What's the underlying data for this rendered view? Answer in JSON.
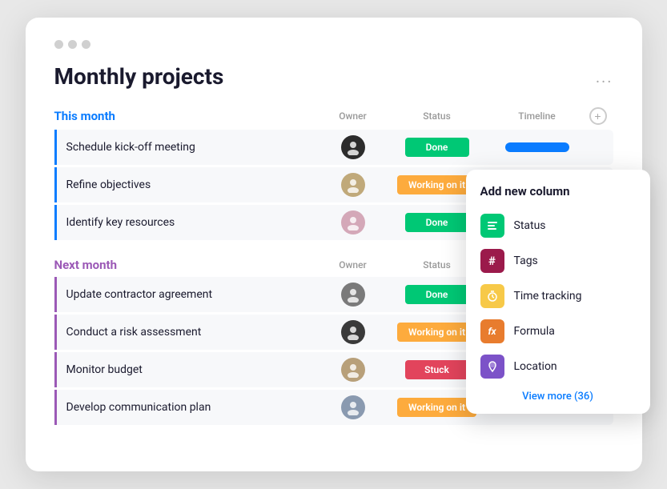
{
  "window": {
    "title": "Monthly projects",
    "more_icon": "···"
  },
  "this_month": {
    "label": "This month",
    "color": "blue",
    "columns": {
      "owner": "Owner",
      "status": "Status",
      "timeline": "Timeline"
    },
    "tasks": [
      {
        "name": "Schedule kick-off meeting",
        "avatar": "av1",
        "avatar_text": "👤",
        "status": "Done",
        "status_class": "status-done",
        "has_timeline": true
      },
      {
        "name": "Refine objectives",
        "avatar": "av2",
        "avatar_text": "👤",
        "status": "Working on it",
        "status_class": "status-working",
        "has_timeline": false
      },
      {
        "name": "Identify key resources",
        "avatar": "av3",
        "avatar_text": "👤",
        "status": "Done",
        "status_class": "status-done",
        "has_timeline": false
      }
    ]
  },
  "next_month": {
    "label": "Next month",
    "color": "purple",
    "columns": {
      "owner": "Owner",
      "status": "Status"
    },
    "tasks": [
      {
        "name": "Update contractor agreement",
        "avatar": "av4",
        "avatar_text": "👤",
        "status": "Done",
        "status_class": "status-done"
      },
      {
        "name": "Conduct a risk assessment",
        "avatar": "av5",
        "avatar_text": "👤",
        "status": "Working on it",
        "status_class": "status-working"
      },
      {
        "name": "Monitor budget",
        "avatar": "av6",
        "avatar_text": "👤",
        "status": "Stuck",
        "status_class": "status-stuck"
      },
      {
        "name": "Develop communication plan",
        "avatar": "av7",
        "avatar_text": "👤",
        "status": "Working on it",
        "status_class": "status-working"
      }
    ]
  },
  "dropdown": {
    "title": "Add new column",
    "items": [
      {
        "label": "Status",
        "icon_class": "icon-status",
        "icon_text": "☰"
      },
      {
        "label": "Tags",
        "icon_class": "icon-tags",
        "icon_text": "#"
      },
      {
        "label": "Time tracking",
        "icon_class": "icon-time",
        "icon_text": "⏱"
      },
      {
        "label": "Formula",
        "icon_class": "icon-formula",
        "icon_text": "fx"
      },
      {
        "label": "Location",
        "icon_class": "icon-location",
        "icon_text": "📍"
      }
    ],
    "view_more": "View more (36)"
  }
}
